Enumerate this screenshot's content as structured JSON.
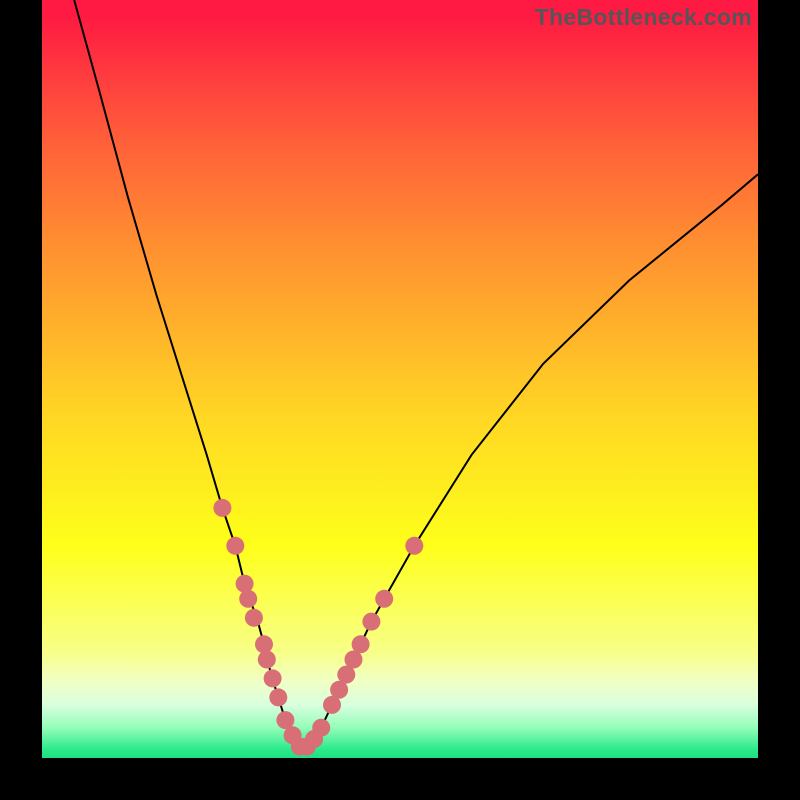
{
  "watermark": "TheBottleneck.com",
  "chart_data": {
    "type": "line",
    "title": "",
    "xlabel": "",
    "ylabel": "",
    "xlim": [
      0,
      100
    ],
    "ylim": [
      0,
      100
    ],
    "note": "Axes unlabeled; values are approximate pixel-fraction positions (0–100) read from the figure. The curve is a V-shaped bottleneck curve with minimum near x≈36.",
    "series": [
      {
        "name": "bottleneck-curve",
        "x": [
          4.5,
          8,
          12,
          16,
          20,
          23,
          25.2,
          27,
          28.3,
          29,
          30,
          31,
          32,
          33,
          34,
          35,
          36,
          37,
          38,
          39,
          40,
          42,
          46,
          52,
          60,
          70,
          82,
          95,
          100
        ],
        "y": [
          100,
          88,
          74,
          61,
          49,
          40,
          33,
          28,
          23,
          21,
          18.5,
          15,
          11,
          8,
          5,
          3,
          1.5,
          1.5,
          2.5,
          4,
          6,
          10,
          18,
          28,
          40,
          52,
          63,
          73,
          77
        ]
      }
    ],
    "markers": {
      "name": "highlight-dots",
      "points": [
        {
          "x": 25.2,
          "y": 33
        },
        {
          "x": 27.0,
          "y": 28
        },
        {
          "x": 28.3,
          "y": 23
        },
        {
          "x": 28.8,
          "y": 21
        },
        {
          "x": 29.6,
          "y": 18.5
        },
        {
          "x": 31.0,
          "y": 15
        },
        {
          "x": 31.4,
          "y": 13
        },
        {
          "x": 32.2,
          "y": 10.5
        },
        {
          "x": 33.0,
          "y": 8
        },
        {
          "x": 34.0,
          "y": 5
        },
        {
          "x": 35.0,
          "y": 3
        },
        {
          "x": 36.0,
          "y": 1.5
        },
        {
          "x": 37.0,
          "y": 1.5
        },
        {
          "x": 38.0,
          "y": 2.5
        },
        {
          "x": 39.0,
          "y": 4
        },
        {
          "x": 40.5,
          "y": 7
        },
        {
          "x": 41.5,
          "y": 9
        },
        {
          "x": 42.5,
          "y": 11
        },
        {
          "x": 43.5,
          "y": 13
        },
        {
          "x": 44.5,
          "y": 15
        },
        {
          "x": 46.0,
          "y": 18
        },
        {
          "x": 47.8,
          "y": 21
        },
        {
          "x": 52.0,
          "y": 28
        }
      ]
    },
    "gradient_bands": [
      {
        "color": "#fe1a42",
        "stop": 0
      },
      {
        "color": "#ff8e31",
        "stop": 32
      },
      {
        "color": "#feff1a",
        "stop": 72
      },
      {
        "color": "#1fe183",
        "stop": 100
      }
    ]
  }
}
